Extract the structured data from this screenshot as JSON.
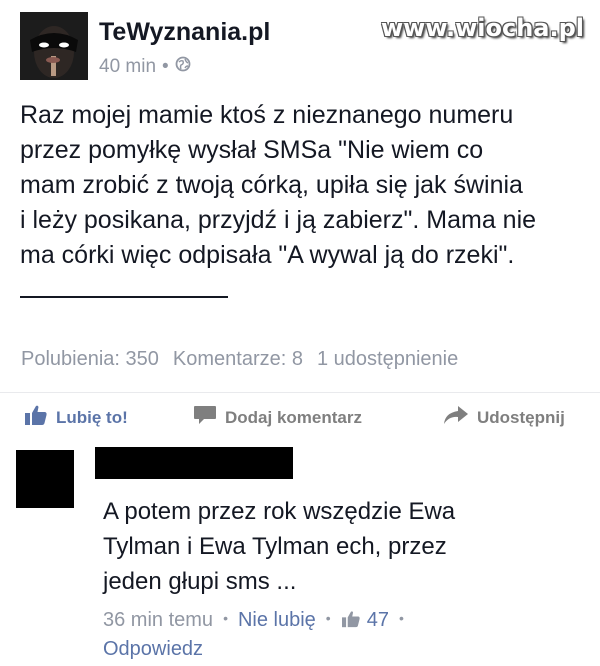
{
  "post": {
    "page_name": "TeWyznania.pl",
    "time": "40 min",
    "text_lines": [
      "Raz mojej mamie ktoś z nieznanego numeru",
      "przez pomyłkę wysłał SMSa \"Nie wiem co",
      "mam zrobić z twoją córką, upiła się jak świnia",
      "i leży posikana, przyjdź i ją zabierz\". Mama nie",
      "ma córki więc odpisała \"A wywal ją do rzeki\"."
    ],
    "stats": {
      "likes": "Polubienia: 350",
      "comments": "Komentarze: 8",
      "shares": "1 udostępnienie"
    },
    "actions": {
      "like": "Lubię to!",
      "comment": "Dodaj komentarz",
      "share": "Udostępnij"
    }
  },
  "watermark": "www.wiocha.pl",
  "comment": {
    "text_lines": [
      "A potem przez rok wszędzie Ewa",
      "Tylman i Ewa Tylman ech, przez",
      "jeden głupi sms ..."
    ],
    "time": "36 min temu",
    "unlike": "Nie lubię",
    "like_count": "47",
    "reply": "Odpowiedz"
  },
  "icons": [
    "globe-icon",
    "thumbs-up-icon",
    "speech-bubble-icon",
    "share-arrow-icon"
  ],
  "colors": {
    "link": "#5b74a8",
    "meta": "#9197a3",
    "text": "#141823"
  }
}
